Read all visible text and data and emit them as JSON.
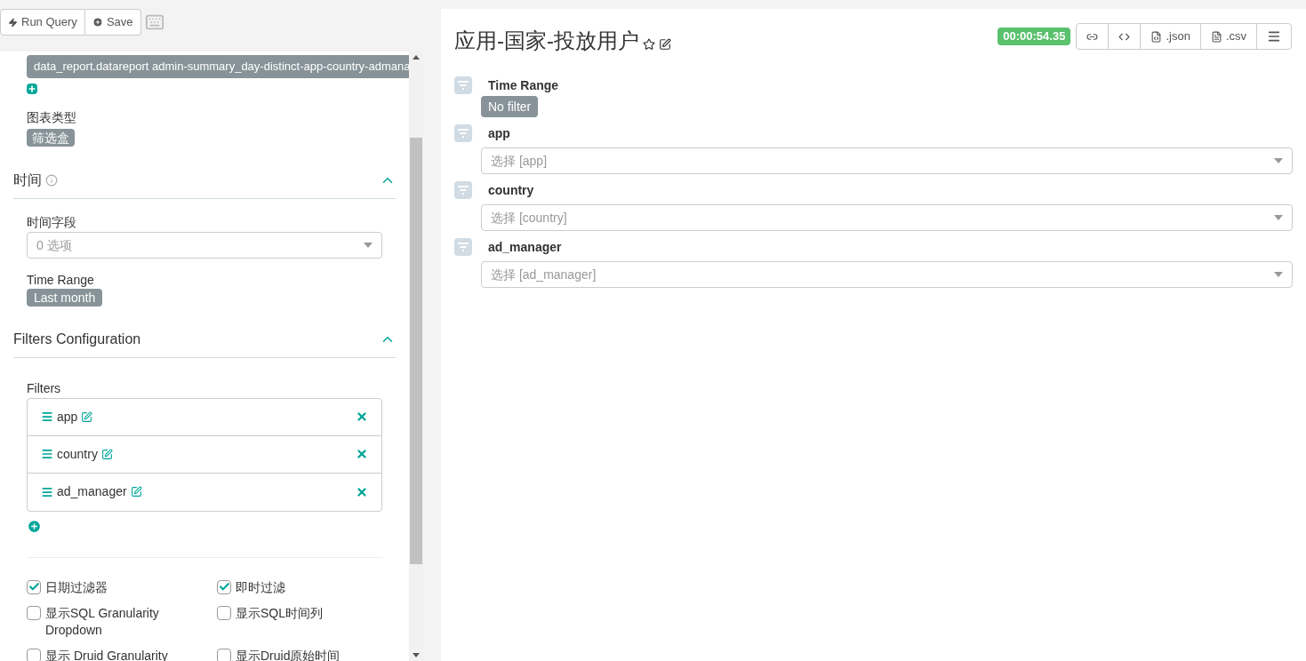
{
  "toolbar": {
    "buttons": [
      {
        "label": "Run Query",
        "kind": "run"
      },
      {
        "label": "Save",
        "kind": "save"
      }
    ]
  },
  "datasource": {
    "value": "data_report.datareport admin-summary_day-distinct-app-country-admana"
  },
  "chart_type": {
    "label": "图表类型",
    "value": "筛选盒"
  },
  "sections": [
    {
      "title": "时间",
      "info": true,
      "expanded": true,
      "kind": "time",
      "field_label": "时间字段",
      "field_placeholder": "0 选项",
      "range_label": "Time Range",
      "range_value": "Last month"
    },
    {
      "title": "Filters Configuration",
      "info": false,
      "expanded": true,
      "kind": "filters",
      "list_label": "Filters",
      "filters": [
        "app",
        "country",
        "ad_manager"
      ]
    }
  ],
  "options": [
    {
      "label": "日期过滤器",
      "checked": true
    },
    {
      "label": "即时过滤",
      "checked": true
    },
    {
      "label": "显示SQL Granularity Dropdown",
      "checked": false
    },
    {
      "label": "显示SQL时间列",
      "checked": false
    },
    {
      "label": "显示 Druid Granularity",
      "checked": false
    },
    {
      "label": "显示Druid原始时间",
      "checked": false
    }
  ],
  "chart": {
    "title": "应用-国家-投放用户",
    "timer": "00:00:54.35",
    "actions": [
      {
        "kind": "link"
      },
      {
        "kind": "code"
      },
      {
        "kind": "json",
        "label": ".json"
      },
      {
        "kind": "csv",
        "label": ".csv"
      },
      {
        "kind": "menu"
      }
    ],
    "filters": [
      {
        "kind": "time",
        "label": "Time Range",
        "value": "No filter"
      },
      {
        "kind": "select",
        "label": "app",
        "placeholder": "选择 [app]"
      },
      {
        "kind": "select",
        "label": "country",
        "placeholder": "选择 [country]"
      },
      {
        "kind": "select",
        "label": "ad_manager",
        "placeholder": "选择 [ad_manager]"
      }
    ]
  }
}
